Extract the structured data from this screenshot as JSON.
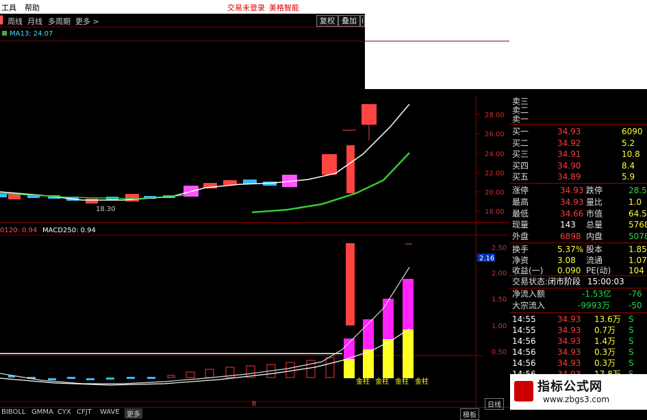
{
  "menu": {
    "tools": "工具",
    "help": "帮助",
    "login_status": "交易未登录",
    "brand": "美格智能"
  },
  "toolbar": {
    "items": [
      "周线",
      "月线",
      "多周期",
      "更多 >"
    ],
    "fq_btn": "复权",
    "overlay_btn": "叠加",
    "extra_btn": "i"
  },
  "main_chart": {
    "ma_label": "MA13: 24.07",
    "low_label": "18.30",
    "y_ticks": [
      "28.00",
      "26.00",
      "24.00",
      "22.00",
      "20.00",
      "18.00"
    ]
  },
  "sub_chart": {
    "label1": "0120: 0.94",
    "label2": "MACD250: 0.94",
    "y_ticks": [
      "2.50",
      "2.00",
      "1.50",
      "1.00",
      "0.50"
    ],
    "current_value": "2.16",
    "golden_labels": [
      "金柱",
      "金柱",
      "金柱",
      "金柱"
    ]
  },
  "quote_panel": {
    "sell_labels": [
      "卖三",
      "卖二",
      "卖一"
    ],
    "buy": [
      {
        "label": "买一",
        "price": "34.93",
        "vol": "6090"
      },
      {
        "label": "买二",
        "price": "34.92",
        "vol": "5.2"
      },
      {
        "label": "买三",
        "price": "34.91",
        "vol": "10.8"
      },
      {
        "label": "买四",
        "price": "34.90",
        "vol": "8.4"
      },
      {
        "label": "买五",
        "price": "34.89",
        "vol": "5.9"
      }
    ],
    "stats": [
      {
        "k1": "涨停",
        "v1": "34.93",
        "k2": "跌停",
        "v2": "28.5"
      },
      {
        "k1": "最高",
        "v1": "34.93",
        "k2": "量比",
        "v2": "1.0"
      },
      {
        "k1": "最低",
        "v1": "34.66",
        "k2": "市值",
        "v2": "64.5"
      },
      {
        "k1": "现量",
        "v1": "143",
        "k2": "总量",
        "v2": "5768"
      },
      {
        "k1": "外盘",
        "v1": "6898",
        "k2": "内盘",
        "v2": "5078"
      }
    ],
    "stats2": [
      {
        "k1": "换手",
        "v1": "5.37%",
        "k2": "股本",
        "v2": "1.85"
      },
      {
        "k1": "净资",
        "v1": "3.08",
        "k2": "流通",
        "v2": "1.07"
      },
      {
        "k1": "收益(一)",
        "v1": "0.090",
        "k2": "PE(动)",
        "v2": "104"
      }
    ],
    "trade_status_label": "交易状态:",
    "trade_status": "闭市阶段",
    "trade_time": "15:00:03",
    "net_inflow_label": "净流入额",
    "net_inflow": "-1.53亿",
    "net_inflow2": "-76",
    "block_inflow_label": "大宗流入",
    "block_inflow": "-9993万",
    "block_inflow2": "-50",
    "ticks": [
      {
        "time": "14:55",
        "price": "34.93",
        "vol": "13.6万",
        "side": "S"
      },
      {
        "time": "14:55",
        "price": "34.93",
        "vol": "0.7万",
        "side": "S"
      },
      {
        "time": "14:56",
        "price": "34.93",
        "vol": "1.4万",
        "side": "S"
      },
      {
        "time": "14:56",
        "price": "34.93",
        "vol": "0.3万",
        "side": "S"
      },
      {
        "time": "14:56",
        "price": "34.93",
        "vol": "0.3万",
        "side": "S"
      },
      {
        "time": "14:56",
        "price": "34.93",
        "vol": "17.8万",
        "side": "S"
      }
    ]
  },
  "tabs": [
    "BIBOLL",
    "GMMA",
    "CYX",
    "CFJT",
    "WAVE",
    "更多"
  ],
  "period_label": "日线",
  "template_btn": "模板",
  "watermark": {
    "title": "指标公式网",
    "url": "www.zbgs3.com"
  }
}
